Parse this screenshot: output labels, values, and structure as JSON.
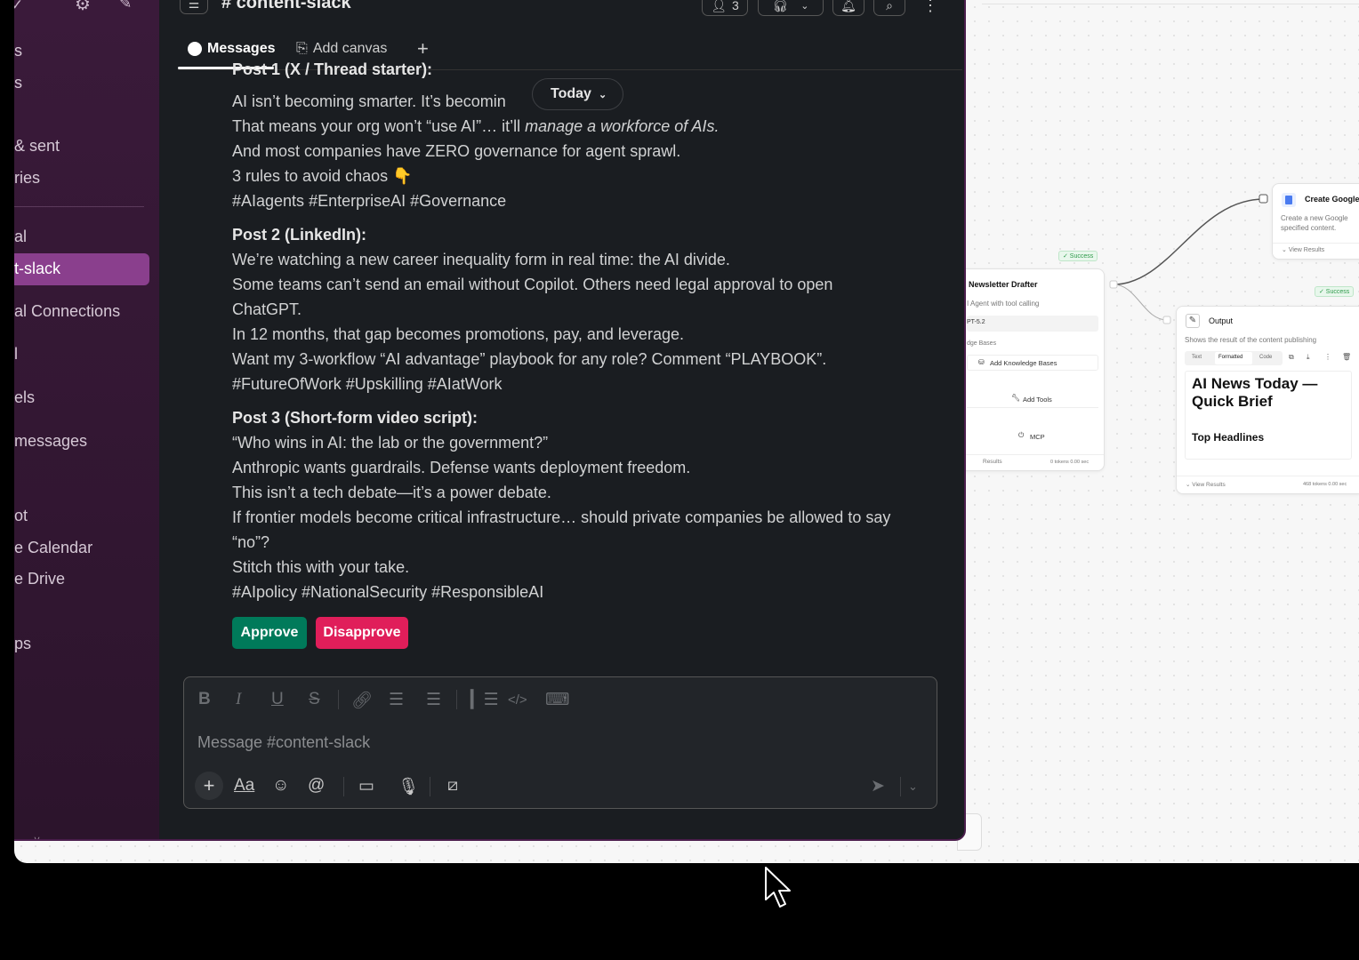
{
  "sidebar": {
    "items": [
      "s",
      "s",
      "& sent",
      "ries",
      "al",
      "t-slack",
      "al Connections",
      "l",
      "els",
      "messages",
      "ot",
      "e Calendar",
      "e Drive",
      "ps"
    ],
    "active_item": "t-slack",
    "footer_chevron": "˅"
  },
  "header": {
    "channel_title": "# content-slack",
    "member_count": "3"
  },
  "tabs": [
    {
      "label": "Messages",
      "icon": "message-icon"
    },
    {
      "label": "Add canvas",
      "icon": "canvas-icon"
    }
  ],
  "date_pill": "Today",
  "message": {
    "post1_heading": "Post 1 (X / Thread starter):",
    "post1_lines": [
      "AI isn’t becoming smarter. It’s becomin",
      "That means your org won’t “use AI”… it’ll ",
      "manage a workforce of AIs.",
      "And most companies have ZERO governance for agent sprawl.",
      "3 rules to avoid chaos 👇",
      "#AIagents #EnterpriseAI #Governance"
    ],
    "post2_heading": "Post 2 (LinkedIn):",
    "post2_lines": [
      "We’re watching a new career inequality form in real time: the AI divide.",
      "Some teams can’t send an email without Copilot. Others need legal approval to open ChatGPT.",
      "In 12 months, that gap becomes promotions, pay, and leverage.",
      "Want my 3-workflow “AI advantage” playbook for any role? Comment “PLAYBOOK”.",
      "#FutureOfWork #Upskilling #AIatWork"
    ],
    "post3_heading": "Post 3 (Short-form video script):",
    "post3_lines": [
      "“Who wins in AI: the lab or the government?”",
      "Anthropic wants guardrails. Defense wants deployment freedom.",
      "This isn’t a tech debate—it’s a power debate.",
      "If frontier models become critical infrastructure… should private companies be allowed to say “no”?",
      "Stitch this with your take.",
      "#AIpolicy #NationalSecurity #ResponsibleAI"
    ]
  },
  "actions": {
    "approve_label": "Approve",
    "disapprove_label": "Disapprove",
    "approve_color": "#007a5a",
    "disapprove_color": "#e01e5a"
  },
  "composer": {
    "placeholder": "Message #content-slack"
  },
  "workflow": {
    "success_label": "✓ Success",
    "create_node": {
      "title": "Create Google",
      "desc_1": "Create a new Google",
      "desc_2": "specified content.",
      "view_results": "View Results"
    },
    "drafter_node": {
      "title": "Newsletter Drafter",
      "desc": "I Agent with tool calling",
      "model": "PT-5.2",
      "kb_label": "dge Bases",
      "add_kb": "Add Knowledge Bases",
      "add_tools": "Add Tools",
      "mcp": "MCP",
      "results": "Results",
      "stats": "0 tokens  0.00 sec"
    },
    "output_node": {
      "title": "Output",
      "desc": "Shows the result of the content publishing",
      "tab_text": "Text",
      "tab_formatted": "Formatted",
      "tab_code": "Code",
      "headline": "AI News Today — Quick Brief",
      "subheading": "Top Headlines",
      "view_results": "View Results",
      "stats": "468 tokens  0.00 sec"
    }
  },
  "colors": {
    "sidebar_bg": "#3a1a3a",
    "active_item": "#8a3f8d",
    "main_bg": "#1a1d21"
  }
}
